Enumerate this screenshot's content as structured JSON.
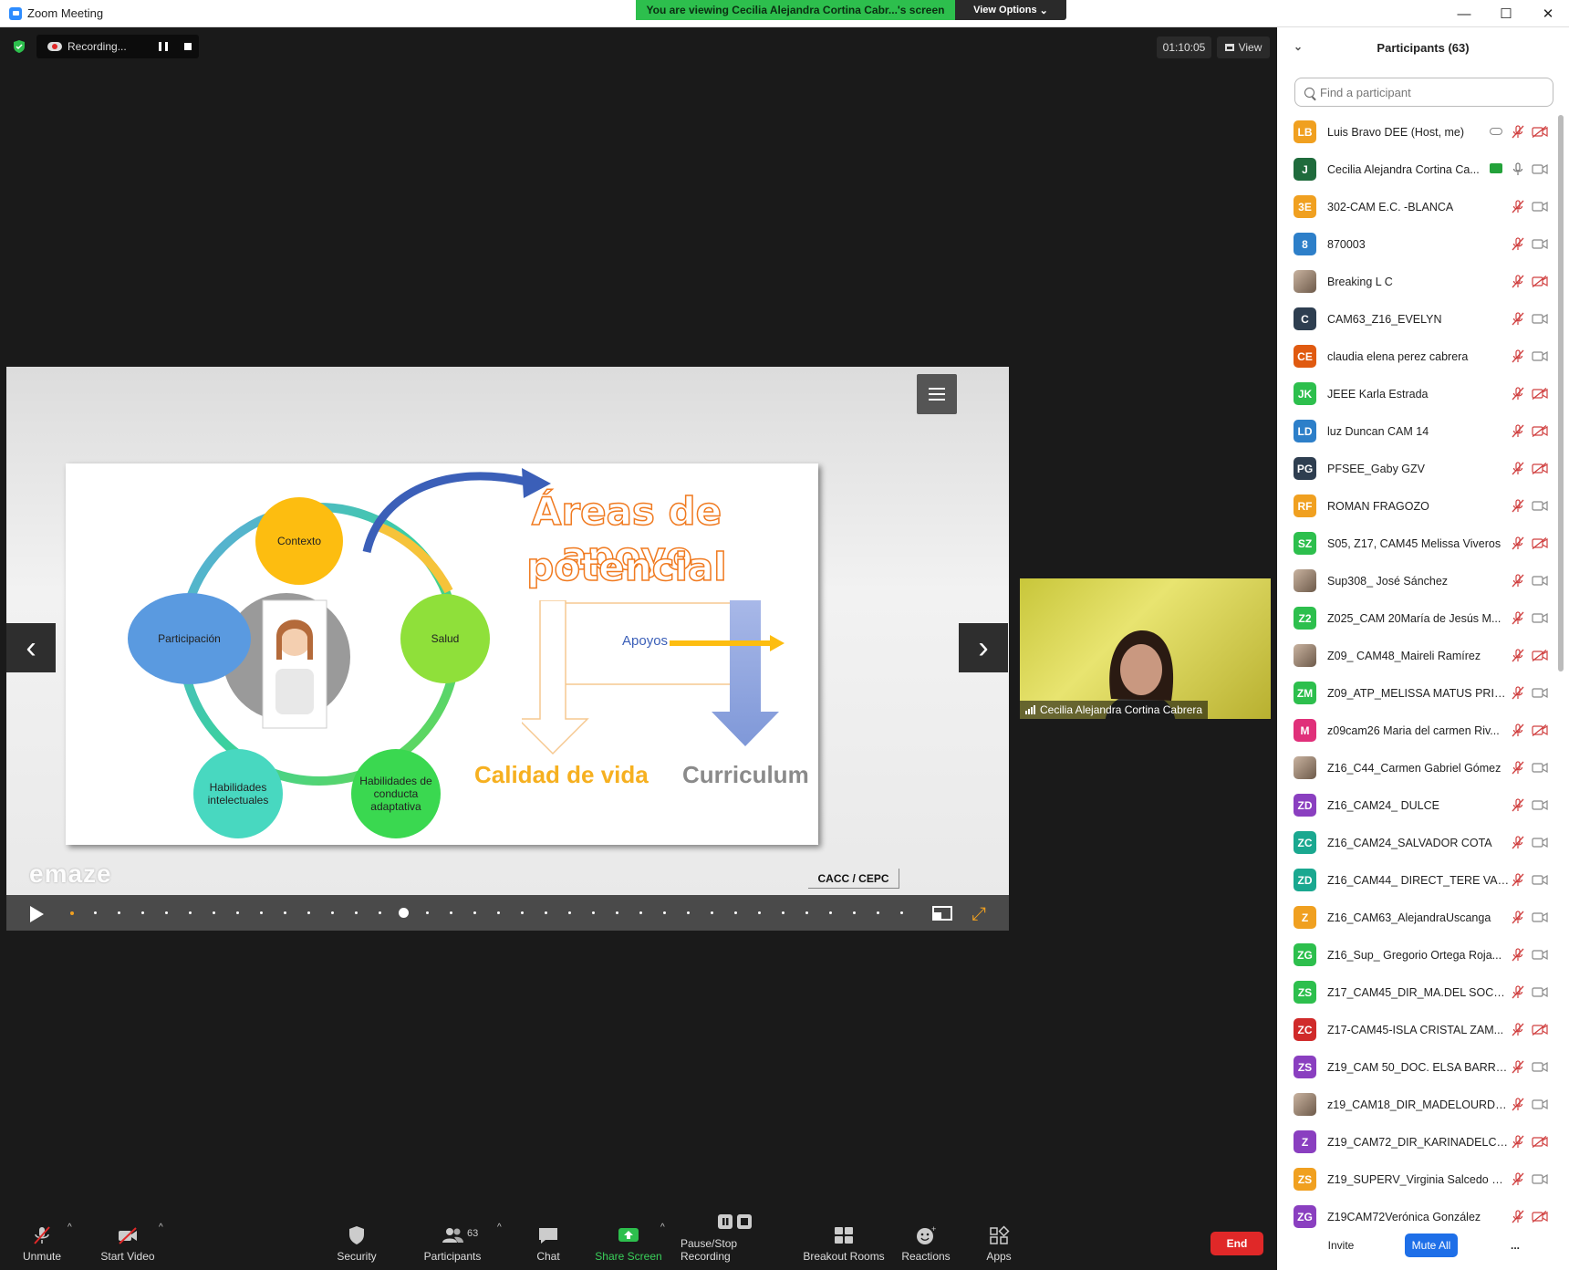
{
  "window": {
    "title": "Zoom Meeting"
  },
  "banner": {
    "viewing": "You are viewing Cecilia Alejandra Cortina Cabr...'s screen",
    "view_options": "View Options"
  },
  "meeting": {
    "recording": "Recording...",
    "timer": "01:10:05",
    "view_label": "View"
  },
  "slide": {
    "title_line1": "Áreas de apoyo",
    "title_line2": "potencial",
    "circles": [
      "Contexto",
      "Salud",
      "Participación",
      "Habilidades intelectuales",
      "Habilidades de conducta adaptativa"
    ],
    "apoyos": "Apoyos",
    "calidad": "Calidad de vida",
    "curriculum": "Curriculum",
    "brand": "emaze",
    "footer_tag": "CACC / CEPC"
  },
  "video": {
    "name": "Cecilia Alejandra Cortina Cabrera"
  },
  "toolbar": {
    "unmute": "Unmute",
    "start_video": "Start Video",
    "security": "Security",
    "participants": "Participants",
    "participant_count": "63",
    "chat": "Chat",
    "share_screen": "Share Screen",
    "pause_stop_recording": "Pause/Stop Recording",
    "breakout_rooms": "Breakout Rooms",
    "reactions": "Reactions",
    "apps": "Apps",
    "end": "End"
  },
  "panel": {
    "title": "Participants (63)",
    "search_placeholder": "Find a participant",
    "invite": "Invite",
    "mute_all": "Mute All",
    "more": "...",
    "participants": [
      {
        "initials": "LB",
        "color": "#f0a020",
        "name": "Luis Bravo DEE (Host, me)",
        "cam_off": true,
        "status": "cloud"
      },
      {
        "initials": "J",
        "color": "#1f6b3c",
        "name": "Cecilia Alejandra Cortina Ca...",
        "cam_off": false,
        "status": "share",
        "mic_on": true
      },
      {
        "initials": "3E",
        "color": "#f0a020",
        "name": "302-CAM E.C. -BLANCA",
        "cam_off": false
      },
      {
        "initials": "8",
        "color": "#2d7fc9",
        "name": "870003",
        "cam_off": false
      },
      {
        "initials": "",
        "color": "photo",
        "name": "Breaking L C",
        "cam_off": true
      },
      {
        "initials": "C",
        "color": "#2e3e50",
        "name": "CAM63_Z16_EVELYN",
        "cam_off": false
      },
      {
        "initials": "CE",
        "color": "#e05a10",
        "name": "claudia elena perez cabrera",
        "cam_off": false
      },
      {
        "initials": "JK",
        "color": "#2dbf4d",
        "name": "JEEE Karla Estrada",
        "cam_off": true
      },
      {
        "initials": "LD",
        "color": "#2d7fc9",
        "name": "luz Duncan CAM 14",
        "cam_off": true
      },
      {
        "initials": "PG",
        "color": "#2e3e50",
        "name": "PFSEE_Gaby GZV",
        "cam_off": true
      },
      {
        "initials": "RF",
        "color": "#f0a020",
        "name": "ROMAN FRAGOZO",
        "cam_off": false
      },
      {
        "initials": "SZ",
        "color": "#2dbf4d",
        "name": "S05, Z17, CAM45 Melissa Viveros",
        "cam_off": true
      },
      {
        "initials": "",
        "color": "photo",
        "name": "Sup308_ José Sánchez",
        "cam_off": false
      },
      {
        "initials": "Z2",
        "color": "#2dbf4d",
        "name": "Z025_CAM 20María de Jesús M...",
        "cam_off": false
      },
      {
        "initials": "",
        "color": "photo",
        "name": "Z09_ CAM48_Maireli Ramírez",
        "cam_off": true
      },
      {
        "initials": "ZM",
        "color": "#2dbf4d",
        "name": "Z09_ATP_MELISSA MATUS PRIETO",
        "cam_off": false
      },
      {
        "initials": "M",
        "color": "#e0307a",
        "name": "z09cam26 Maria del carmen Riv...",
        "cam_off": true
      },
      {
        "initials": "",
        "color": "photo",
        "name": "Z16_C44_Carmen Gabriel Gómez",
        "cam_off": false
      },
      {
        "initials": "ZD",
        "color": "#8a3fc0",
        "name": "Z16_CAM24_ DULCE",
        "cam_off": false
      },
      {
        "initials": "ZC",
        "color": "#1aa890",
        "name": "Z16_CAM24_SALVADOR COTA",
        "cam_off": false
      },
      {
        "initials": "ZD",
        "color": "#1aa890",
        "name": "Z16_CAM44_ DIRECT_TERE VAS...",
        "cam_off": false
      },
      {
        "initials": "Z",
        "color": "#f0a020",
        "name": "Z16_CAM63_AlejandraUscanga",
        "cam_off": false
      },
      {
        "initials": "ZG",
        "color": "#2dbf4d",
        "name": "Z16_Sup_ Gregorio Ortega Roja...",
        "cam_off": false
      },
      {
        "initials": "ZS",
        "color": "#2dbf4d",
        "name": "Z17_CAM45_DIR_MA.DEL SOCO...",
        "cam_off": false
      },
      {
        "initials": "ZC",
        "color": "#d02a2a",
        "name": "Z17-CAM45-ISLA CRISTAL ZAM...",
        "cam_off": true
      },
      {
        "initials": "ZS",
        "color": "#8a3fc0",
        "name": "Z19_CAM 50_DOC. ELSA BARRA...",
        "cam_off": false
      },
      {
        "initials": "",
        "color": "photo",
        "name": "z19_CAM18_DIR_MADELOURDE...",
        "cam_off": false
      },
      {
        "initials": "Z",
        "color": "#8a3fc0",
        "name": "Z19_CAM72_DIR_KARINADELCA...",
        "cam_off": true
      },
      {
        "initials": "ZS",
        "color": "#f0a020",
        "name": "Z19_SUPERV_Virginia Salcedo Q...",
        "cam_off": false
      },
      {
        "initials": "ZG",
        "color": "#8a3fc0",
        "name": "Z19CAM72Verónica González",
        "cam_off": true
      }
    ]
  }
}
